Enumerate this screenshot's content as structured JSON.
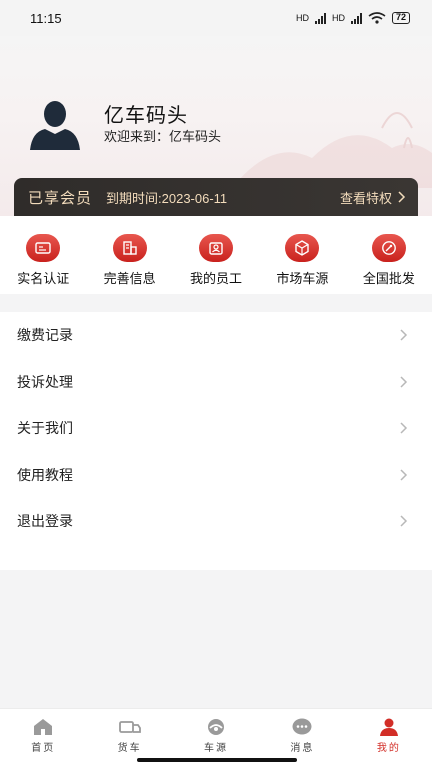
{
  "status_bar": {
    "time": "11:15",
    "net1": "HD",
    "net2": "HD",
    "battery": "72"
  },
  "profile": {
    "name": "亿车码头",
    "welcome": "欢迎来到：亿车码头"
  },
  "membership": {
    "title": "已享会员",
    "expire": "到期时间:2023-06-11",
    "link_label": "查看特权"
  },
  "quick_actions": [
    {
      "label": "实名认证",
      "icon": "id-card-icon"
    },
    {
      "label": "完善信息",
      "icon": "building-icon"
    },
    {
      "label": "我的员工",
      "icon": "employee-badge-icon"
    },
    {
      "label": "市场车源",
      "icon": "cube-icon"
    },
    {
      "label": "全国批发",
      "icon": "compass-icon"
    }
  ],
  "menu": [
    {
      "label": "缴费记录"
    },
    {
      "label": "投诉处理"
    },
    {
      "label": "关于我们"
    },
    {
      "label": "使用教程"
    },
    {
      "label": "退出登录"
    }
  ],
  "tabs": [
    {
      "label": "首页",
      "icon": "home-icon"
    },
    {
      "label": "货车",
      "icon": "truck-icon"
    },
    {
      "label": "车源",
      "icon": "car-source-icon"
    },
    {
      "label": "消息",
      "icon": "message-icon"
    },
    {
      "label": "我的",
      "icon": "profile-icon",
      "active": true
    }
  ],
  "colors": {
    "accent": "#d22e27",
    "card_bg": "#2f2c2a",
    "card_text": "#f3dcbc"
  }
}
